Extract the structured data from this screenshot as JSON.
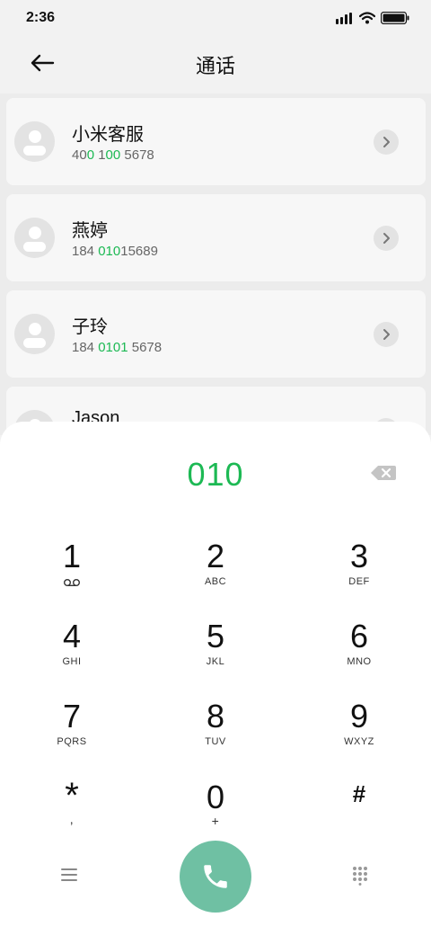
{
  "status_bar": {
    "time": "2:36"
  },
  "header": {
    "title": "通话"
  },
  "contacts": [
    {
      "name": "小米客服",
      "num_pre": "400 ",
      "num_hl": "010",
      "num_mid": "",
      "num_hl2": "",
      "num_post": "0 5678",
      "display": [
        "400 1",
        "00 10",
        "0 5678"
      ]
    },
    {
      "name": "燕婷",
      "num_pre": "184 ",
      "num_hl": "010",
      "num_post": "15689"
    },
    {
      "name": "子玲",
      "num_pre": "184 ",
      "num_hl": "0101",
      "num_post": " 5678"
    },
    {
      "name": "Jason"
    }
  ],
  "contact1_number": {
    "a": "40",
    "b": "0",
    "c": " 1",
    "d": "00",
    "e": " 5678"
  },
  "dialer": {
    "entered": "010",
    "keys": [
      {
        "digit": "1",
        "letters": ""
      },
      {
        "digit": "2",
        "letters": "ABC"
      },
      {
        "digit": "3",
        "letters": "DEF"
      },
      {
        "digit": "4",
        "letters": "GHI"
      },
      {
        "digit": "5",
        "letters": "JKL"
      },
      {
        "digit": "6",
        "letters": "MNO"
      },
      {
        "digit": "7",
        "letters": "PQRS"
      },
      {
        "digit": "8",
        "letters": "TUV"
      },
      {
        "digit": "9",
        "letters": "WXYZ"
      },
      {
        "digit": "*",
        "letters": ","
      },
      {
        "digit": "0",
        "letters": "+"
      },
      {
        "digit": "#",
        "letters": ""
      }
    ]
  },
  "colors": {
    "accent": "#1db954",
    "call_button": "#6fc0a3"
  },
  "icons": {
    "back": "arrow-left-icon",
    "backspace": "backspace-icon",
    "menu": "menu-icon",
    "call": "phone-icon",
    "keypad": "keypad-icon",
    "voicemail": "voicemail-icon"
  }
}
